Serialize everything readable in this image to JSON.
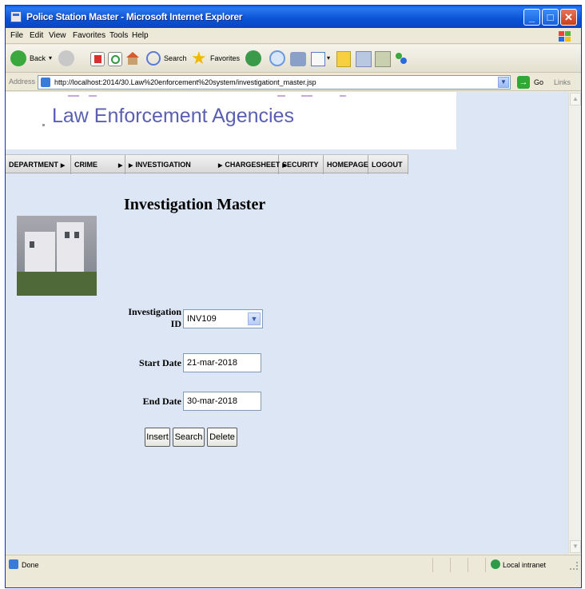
{
  "window": {
    "title": "Police Station Master - Microsoft Internet Explorer"
  },
  "menu": [
    "File",
    "Edit",
    "View",
    "Favorites",
    "Tools",
    "Help"
  ],
  "toolbar": {
    "back_label": "Back",
    "search_label": "Search",
    "favorites_label": "Favorites"
  },
  "address": {
    "label": "Address",
    "url": "http://localhost:2014/30.Law%20enforcement%20system/investigationt_master.jsp",
    "go_label": "Go",
    "links_label": "Links"
  },
  "banner": {
    "title": "Law Enforcement Agencies"
  },
  "nav": [
    {
      "label": "DEPARTMENT",
      "arrow": "▶"
    },
    {
      "label": "CRIME",
      "arrow": "▶"
    },
    {
      "label": "INVESTIGATION",
      "arrow": "▶"
    },
    {
      "label": "CHARGESHEET",
      "arrow": "▶"
    },
    {
      "label": "SECURITY",
      "arrow": "▶"
    },
    {
      "label": "HOMEPAGE",
      "arrow": ""
    },
    {
      "label": "LOGOUT",
      "arrow": ""
    }
  ],
  "page": {
    "heading": "Investigation Master"
  },
  "form": {
    "investigation_id_label_line1": "Investigation",
    "investigation_id_label_line2": "ID",
    "investigation_id_value": "INV109",
    "start_date_label": "Start Date",
    "start_date_value": "21-mar-2018",
    "end_date_label": "End Date",
    "end_date_value": "30-mar-2018",
    "insert_label": "Insert",
    "search_label": "Search",
    "delete_label": "Delete"
  },
  "status": {
    "text": "Done",
    "zone": "Local intranet"
  },
  "colors": {
    "titlebar": "#0a52d6",
    "banner_text": "#5a5fb4",
    "page_bg": "#dce6f4"
  }
}
